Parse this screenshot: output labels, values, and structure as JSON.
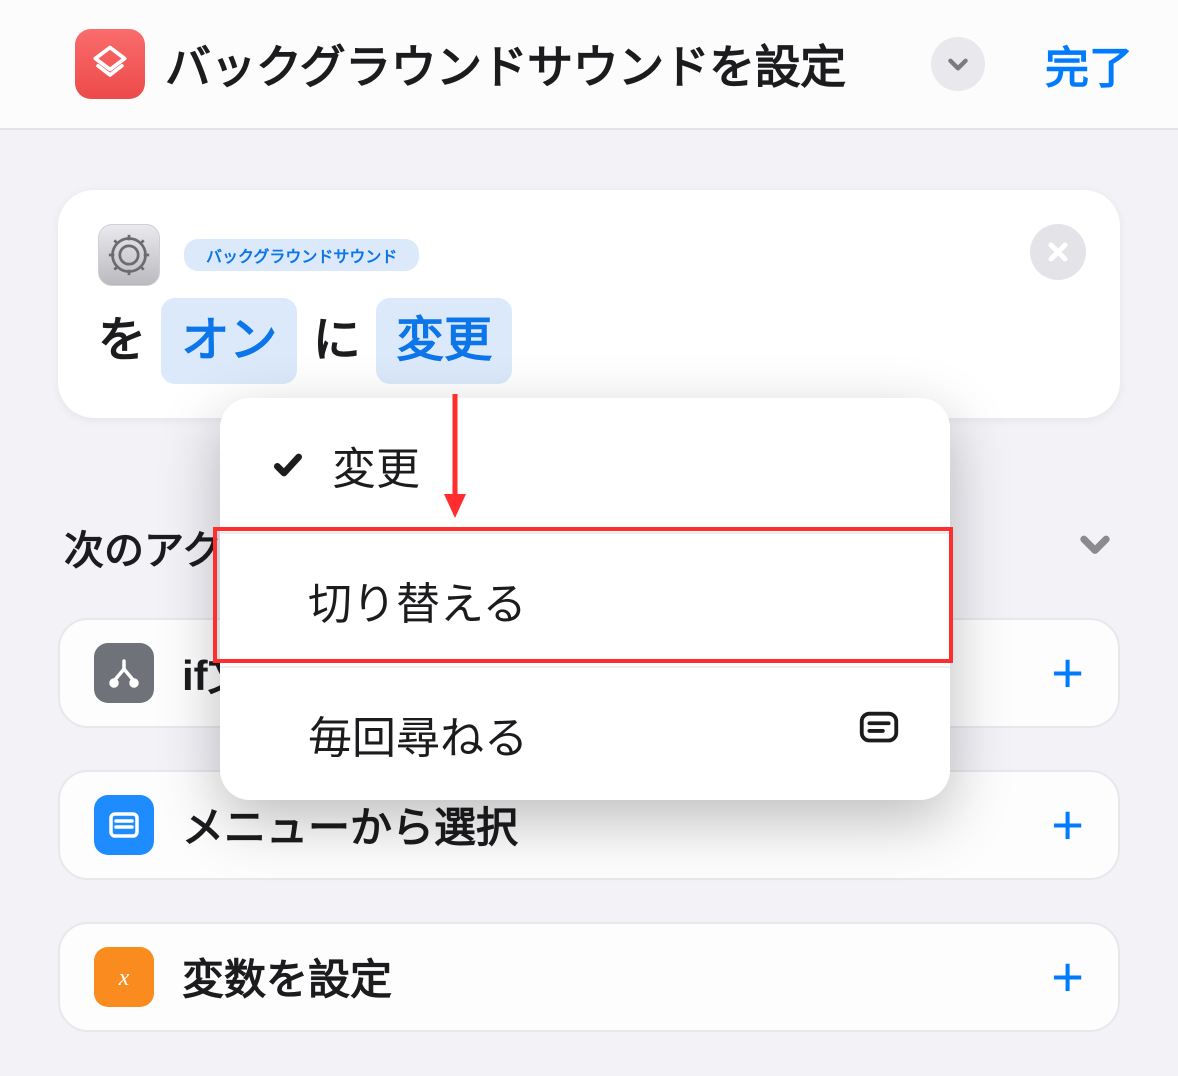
{
  "header": {
    "title": "バックグラウンドサウンドを設定",
    "done": "完了"
  },
  "action": {
    "param_target": "バックグラウンドサウンド",
    "connector1": "を",
    "param_state": "オン",
    "connector2": "に",
    "param_operation": "変更"
  },
  "popover": {
    "items": [
      {
        "label": "変更",
        "checked": true
      },
      {
        "label": "切り替える",
        "checked": false
      },
      {
        "label": "毎回尋ねる",
        "checked": false,
        "trailing": "message"
      }
    ]
  },
  "suggestions": {
    "title": "次のアクションの提案",
    "items": [
      {
        "icon": "if",
        "label": "if文"
      },
      {
        "icon": "menu",
        "label": "メニューから選択"
      },
      {
        "icon": "var",
        "label": "変数を設定"
      }
    ]
  }
}
